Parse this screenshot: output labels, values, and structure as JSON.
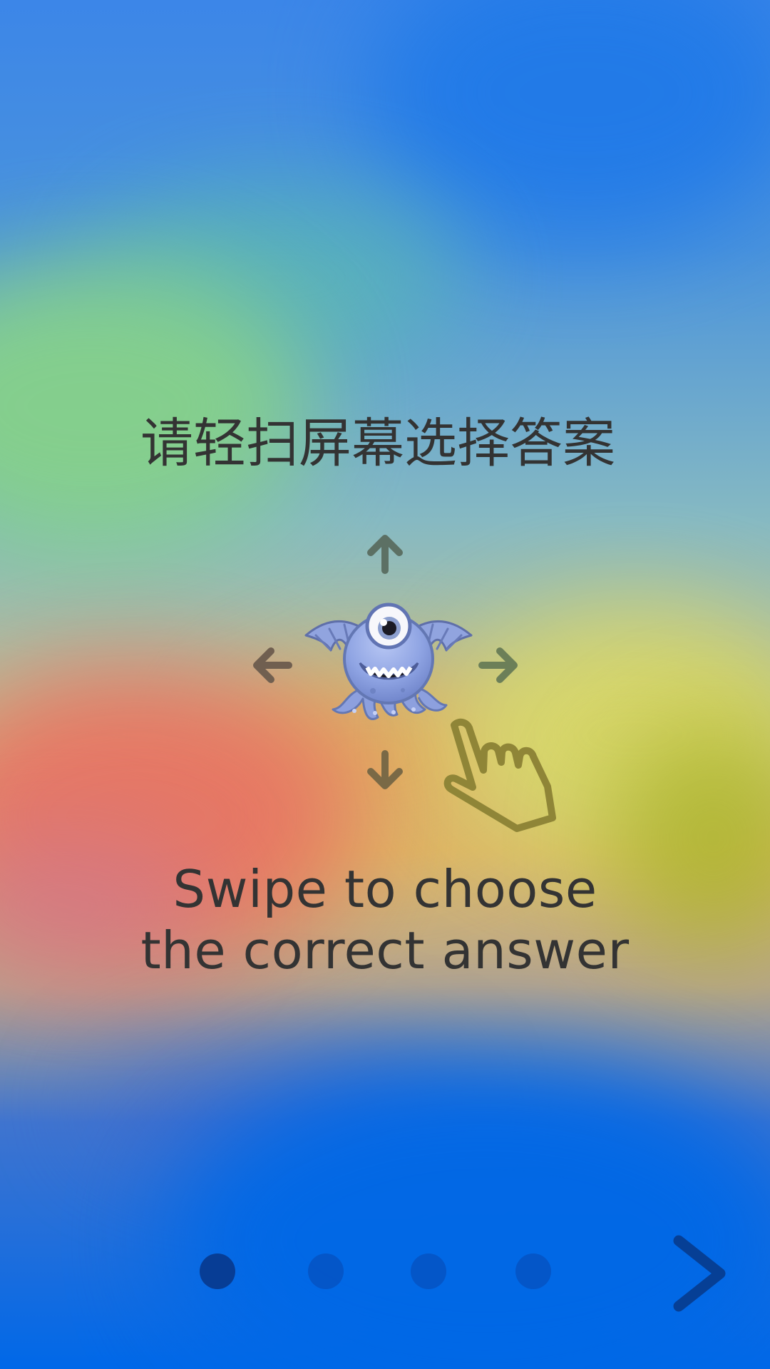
{
  "screen": {
    "title_cn": "请轻扫屏幕选择答案",
    "subtitle_en": "Swipe to choose the correct answer"
  },
  "illustration": {
    "arrows": [
      {
        "direction": "up",
        "icon": "arrow-up-icon"
      },
      {
        "direction": "left",
        "icon": "arrow-left-icon"
      },
      {
        "direction": "right",
        "icon": "arrow-right-icon"
      },
      {
        "direction": "down",
        "icon": "arrow-down-icon"
      }
    ],
    "monster_icon": "one-eyed-monster-icon",
    "hand_icon": "pointing-hand-icon"
  },
  "pager": {
    "page_count": 4,
    "current_page": 1
  },
  "next_button": {
    "icon": "chevron-right-icon"
  },
  "colors": {
    "text": "#333333",
    "active_dot": "#073d95",
    "inactive_dot": "#0b58c4",
    "accent_blue": "#006ae8"
  }
}
